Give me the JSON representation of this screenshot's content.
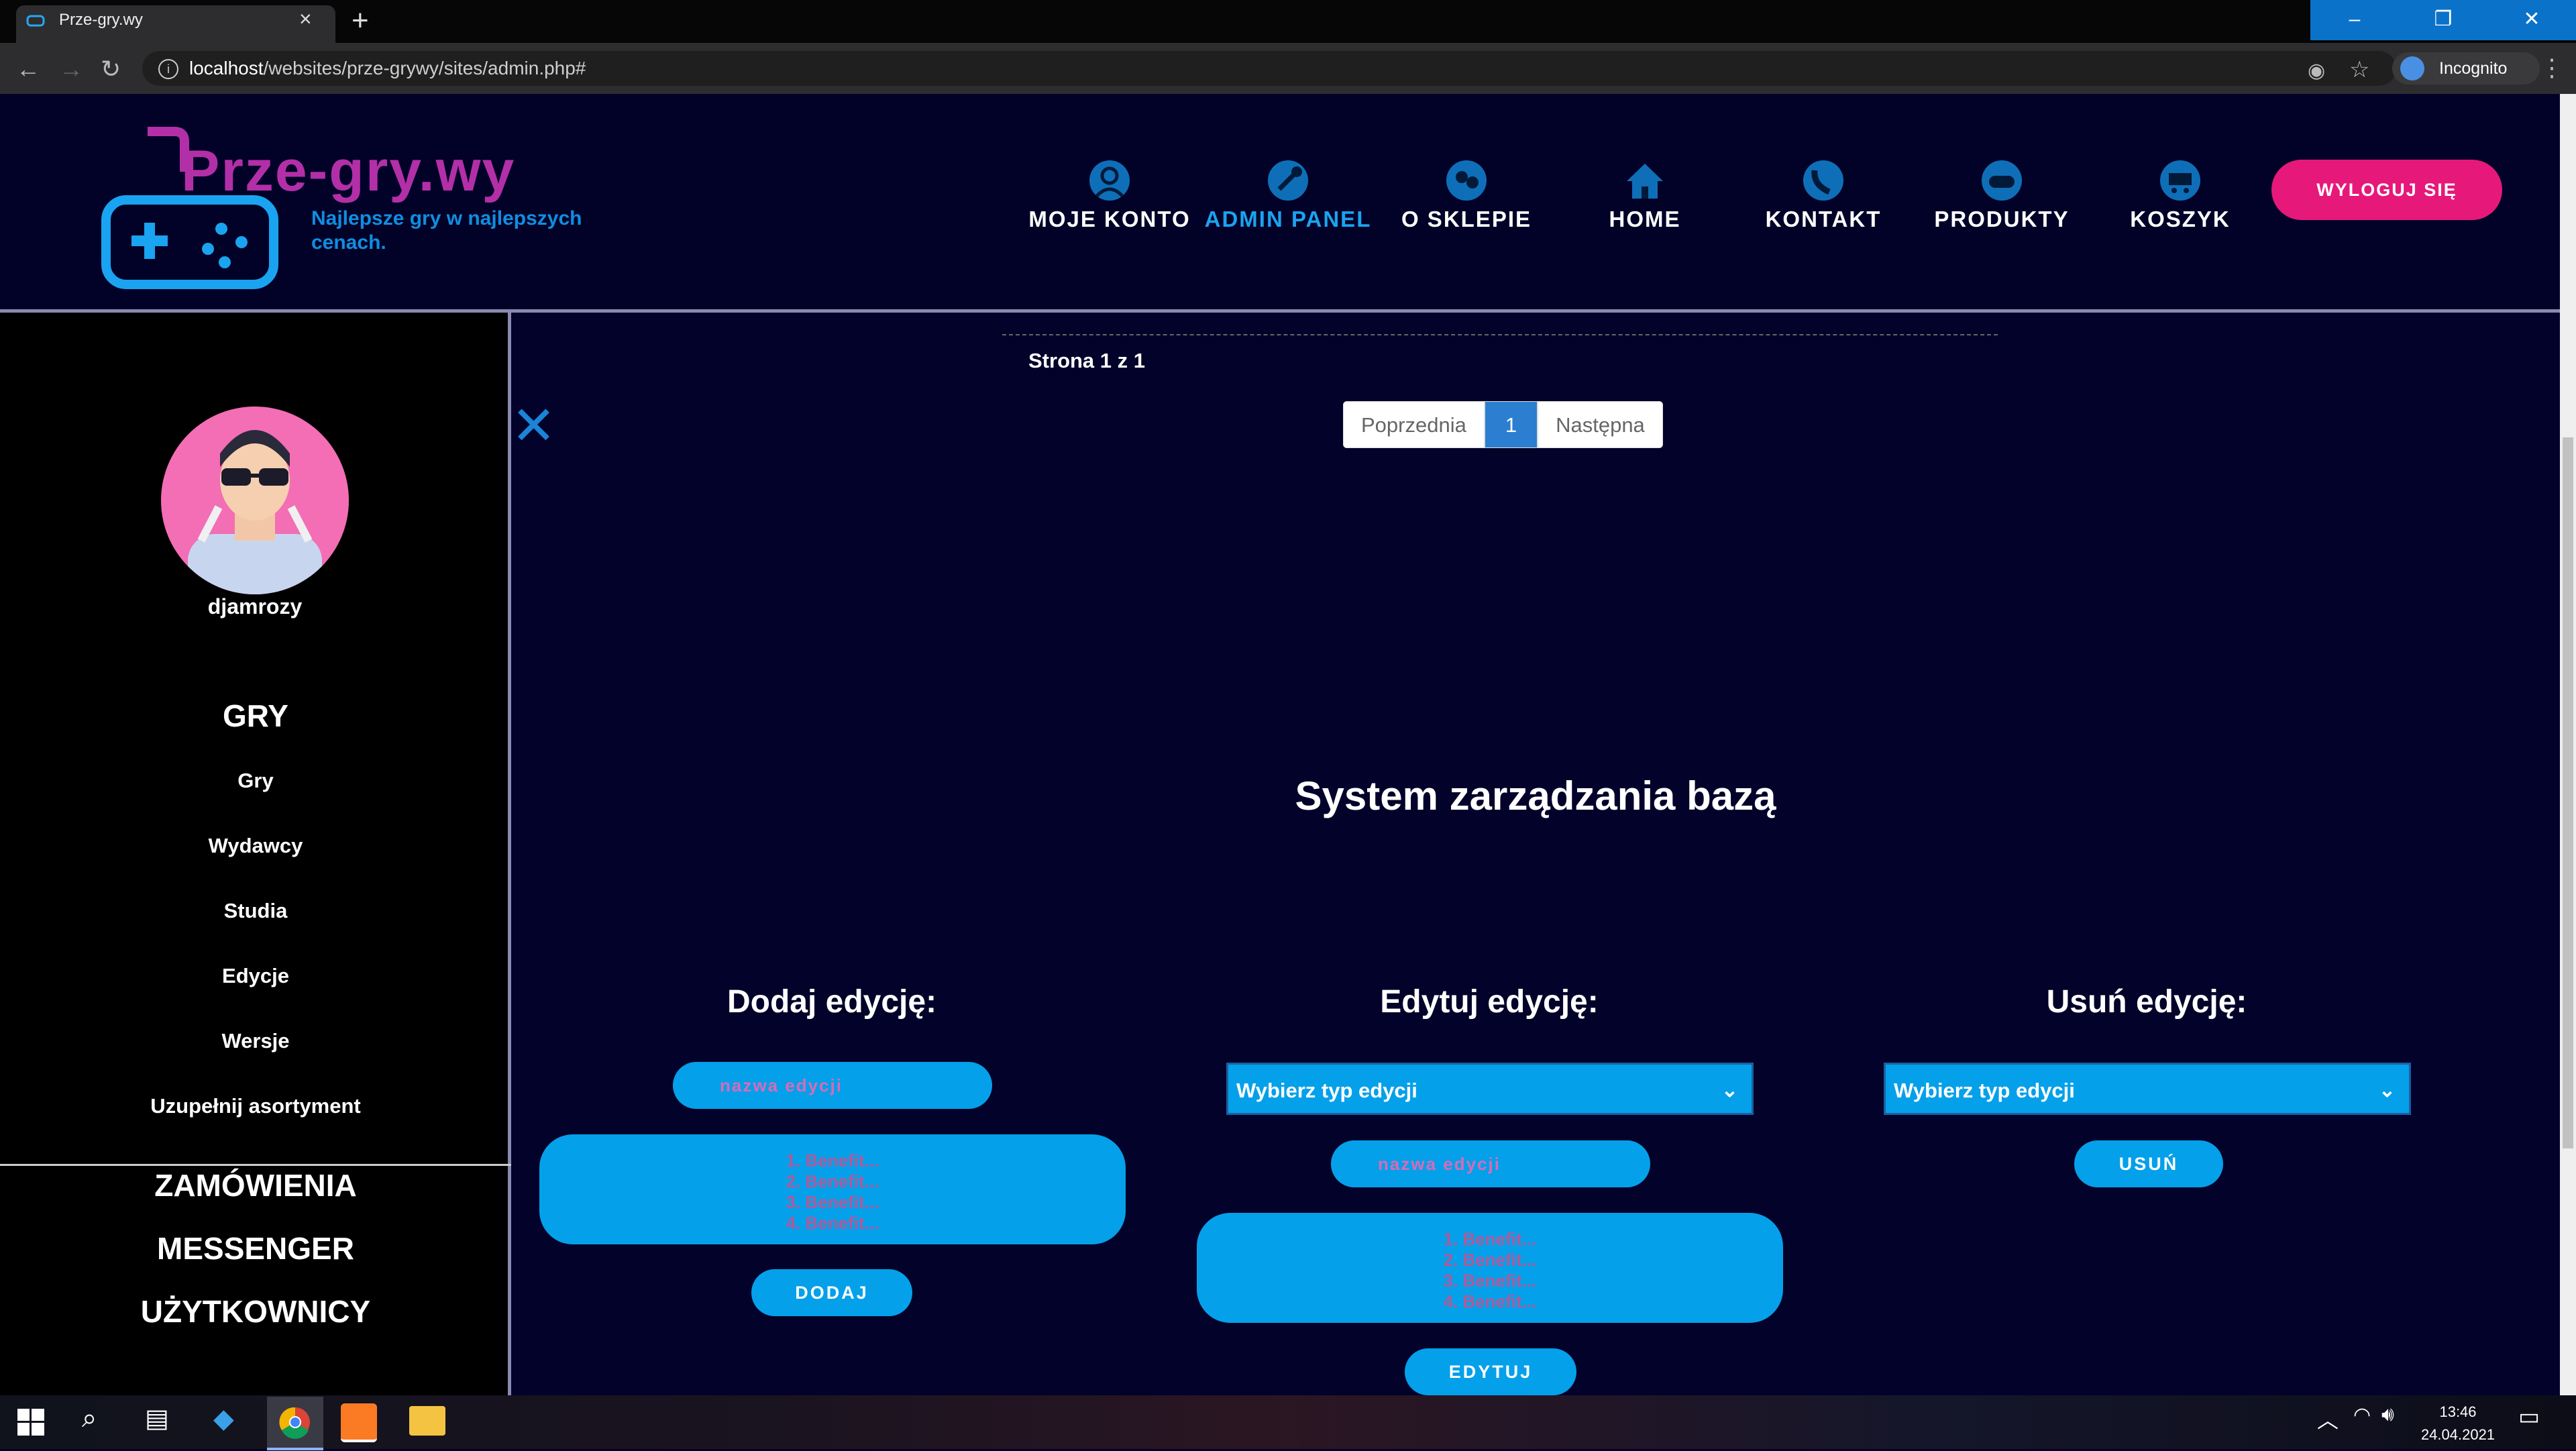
{
  "browser": {
    "tab_title": "Prze-gry.wy",
    "close_tab": "×",
    "new_tab": "+",
    "url_host": "localhost",
    "url_path": "/websites/prze-grywy/sites/admin.php#",
    "incognito_label": "Incognito",
    "window_buttons": [
      "–",
      "❐",
      "✕"
    ]
  },
  "header": {
    "logo_text": "Prze-gry.wy",
    "logo_tagline": "Najlepsze gry w najlepszych cenach.",
    "nav": [
      {
        "label": "MOJE KONTO",
        "icon": "account-icon"
      },
      {
        "label": "ADMIN PANEL",
        "icon": "admin-icon",
        "active": true
      },
      {
        "label": "O SKLEPIE",
        "icon": "about-icon"
      },
      {
        "label": "HOME",
        "icon": "home-icon"
      },
      {
        "label": "KONTAKT",
        "icon": "phone-icon"
      },
      {
        "label": "PRODUKTY",
        "icon": "gamepad-icon"
      },
      {
        "label": "KOSZYK",
        "icon": "cart-icon"
      }
    ],
    "logout_label": "WYLOGUJ SIĘ"
  },
  "sidebar": {
    "username": "djamrozy",
    "section_games": "GRY",
    "items": [
      "Gry",
      "Wydawcy",
      "Studia",
      "Edycje",
      "Wersje",
      "Uzupełnij asortyment"
    ],
    "orders": "ZAMÓWIENIA",
    "messenger": "MESSENGER",
    "users": "UŻYTKOWNICY"
  },
  "pagination": {
    "page_info": "Strona 1 z 1",
    "prev": "Poprzednia",
    "current": "1",
    "next": "Następna"
  },
  "main": {
    "title": "System zarządzania bazą",
    "add": {
      "title": "Dodaj edycję:",
      "name_placeholder": "nazwa edycji",
      "benefits_placeholder": "1. Benefit...\n2. Benefit...\n3. Benefit...\n4. Benefit...",
      "button": "DODAJ"
    },
    "edit": {
      "title": "Edytuj edycję:",
      "select_value": "Wybierz typ edycji",
      "name_placeholder": "nazwa edycji",
      "benefits_placeholder": "1. Benefit...\n2. Benefit...\n3. Benefit...\n4. Benefit...",
      "button": "EDYTUJ"
    },
    "delete": {
      "title": "Usuń edycję:",
      "select_value": "Wybierz typ edycji",
      "button": "USUŃ"
    }
  },
  "taskbar": {
    "time": "13:46",
    "date": "24.04.2021"
  },
  "colors": {
    "accent": "#05a0ea",
    "logout": "#e6197a",
    "logo": "#b32fa8",
    "background": "#02022a"
  }
}
